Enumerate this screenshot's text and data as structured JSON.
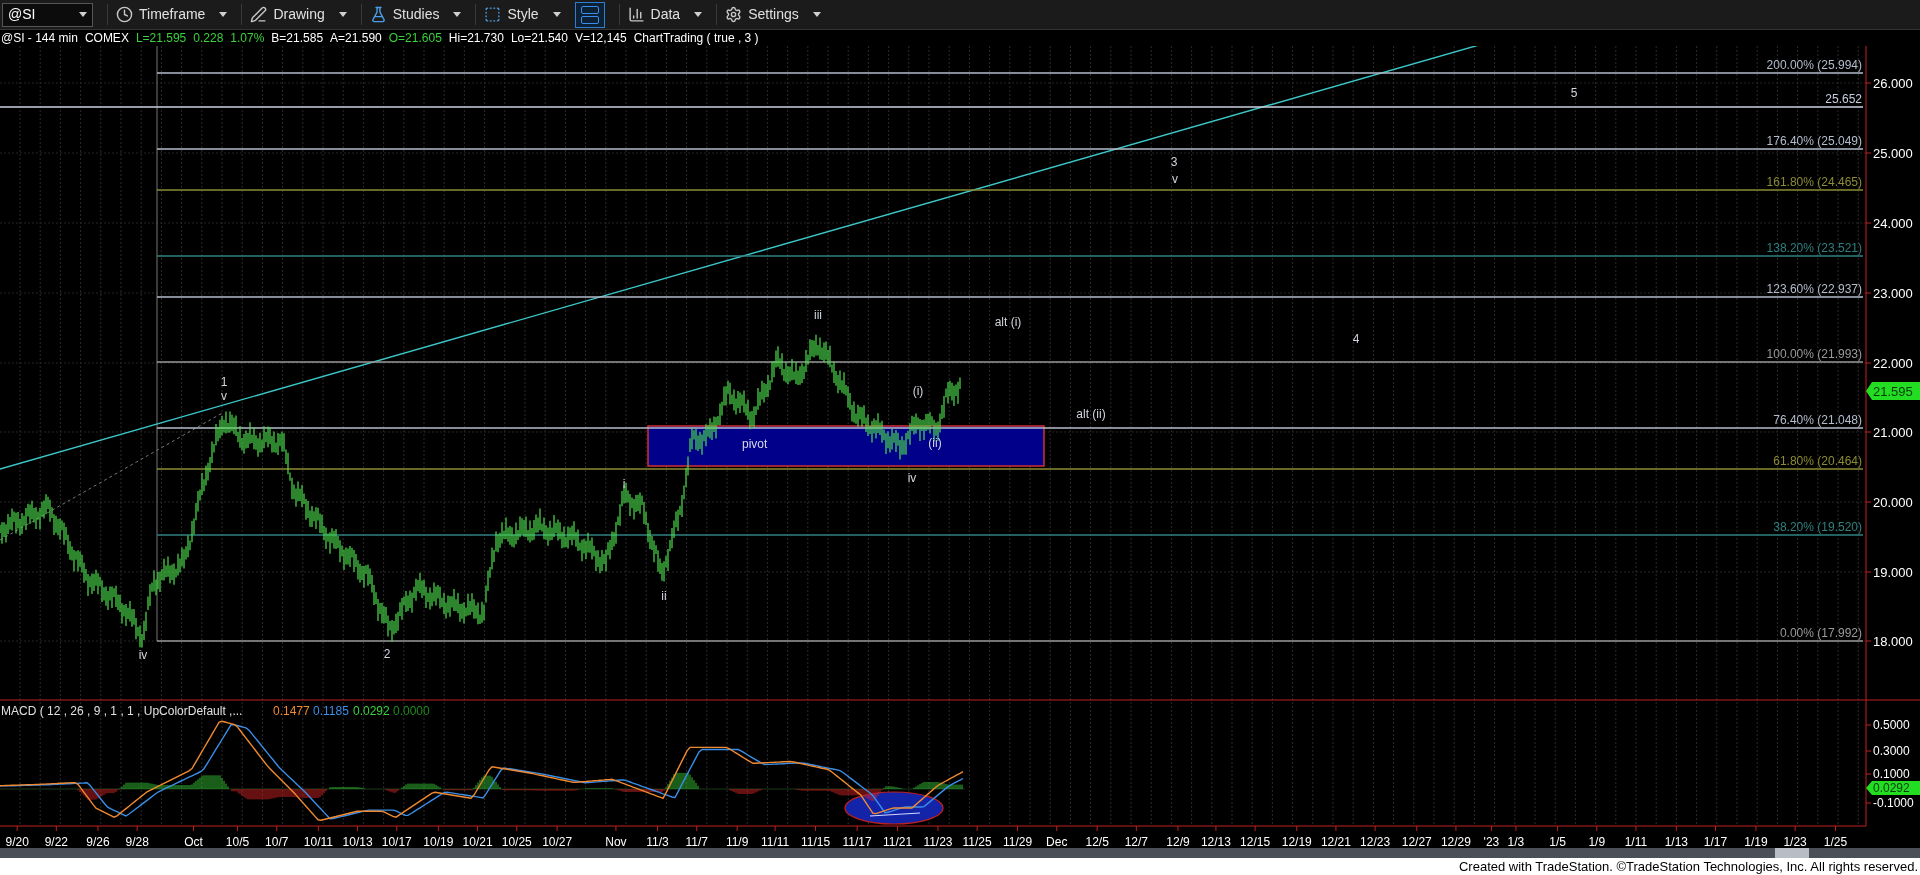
{
  "toolbar": {
    "symbol": "@SI",
    "menus": [
      {
        "label": "Timeframe"
      },
      {
        "label": "Drawing"
      },
      {
        "label": "Studies"
      },
      {
        "label": "Style"
      },
      {
        "label": "Data"
      },
      {
        "label": "Settings"
      }
    ],
    "layout_toggle": {
      "selected": true
    }
  },
  "info_line": [
    {
      "text": "@SI - 144 min",
      "color": "#ffffff"
    },
    {
      "text": "COMEX",
      "color": "#ffffff"
    },
    {
      "text": "L=21.595",
      "color": "#3ad13a"
    },
    {
      "text": "0.228",
      "color": "#3ad13a"
    },
    {
      "text": "1.07%",
      "color": "#3ad13a"
    },
    {
      "text": "B=21.585",
      "color": "#ffffff"
    },
    {
      "text": "A=21.590",
      "color": "#ffffff"
    },
    {
      "text": "O=21.605",
      "color": "#3ad13a"
    },
    {
      "text": "Hi=21.730",
      "color": "#ffffff"
    },
    {
      "text": "Lo=21.540",
      "color": "#ffffff"
    },
    {
      "text": "V=12,145",
      "color": "#ffffff"
    },
    {
      "text": "ChartTrading ( true , 3 )",
      "color": "#ffffff"
    }
  ],
  "price_axis": {
    "ticks": [
      "26.000",
      "25.000",
      "24.000",
      "23.000",
      "22.000",
      "21.000",
      "20.000",
      "19.000",
      "18.000"
    ],
    "last_price": "21.595"
  },
  "fib_levels": [
    {
      "label": "200.00% (25.994)",
      "color": "#b4bccc"
    },
    {
      "label": "25.652",
      "color": "#c8d0e0"
    },
    {
      "label": "176.40% (25.049)",
      "color": "#b4bccc"
    },
    {
      "label": "161.80% (24.465)",
      "color": "#8c8c34"
    },
    {
      "label": "138.20% (23.521)",
      "color": "#2f8080"
    },
    {
      "label": "123.60% (22.937)",
      "color": "#b4bccc"
    },
    {
      "label": "100.00% (21.993)",
      "color": "#9a9a9a"
    },
    {
      "label": "76.40% (21.048)",
      "color": "#b4bccc"
    },
    {
      "label": "61.80% (20.464)",
      "color": "#8c8c34"
    },
    {
      "label": "38.20% (19.520)",
      "color": "#2f8080"
    },
    {
      "label": "0.00% (17.992)",
      "color": "#9a9a9a"
    }
  ],
  "zone": {
    "label": "pivot"
  },
  "wave_labels": [
    "1",
    "v",
    "iv",
    "2",
    "i",
    "ii",
    "iii",
    "iv",
    "(i)",
    "(ii)",
    "alt (i)",
    "alt (ii)",
    "3",
    "v",
    "4",
    "5"
  ],
  "macd": {
    "title": "MACD ( 12 , 26 , 9 , 1 , 1 , UpColorDefault ,...",
    "values": [
      {
        "text": "0.1477",
        "color": "#f08a30"
      },
      {
        "text": "0.1185",
        "color": "#3a8ee8"
      },
      {
        "text": "0.0292",
        "color": "#3ad13a"
      },
      {
        "text": "0.0000",
        "color": "#1f8a1f"
      }
    ],
    "ticks": [
      "0.5000",
      "0.3000",
      "0.1000",
      "-0.1000"
    ],
    "last_value": "0.0292"
  },
  "dates": [
    "9/20",
    "9/22",
    "9/26",
    "9/28",
    "Oct",
    "10/5",
    "10/7",
    "10/11",
    "10/13",
    "10/17",
    "10/19",
    "10/21",
    "10/25",
    "10/27",
    "Nov",
    "11/3",
    "11/7",
    "11/9",
    "11/11",
    "11/15",
    "11/17",
    "11/21",
    "11/23",
    "11/25",
    "11/29",
    "Dec",
    "12/5",
    "12/7",
    "12/9",
    "12/13",
    "12/15",
    "12/19",
    "12/21",
    "12/23",
    "12/27",
    "12/29",
    "'23",
    "1/3",
    "1/5",
    "1/9",
    "1/11",
    "1/13",
    "1/17",
    "1/19",
    "1/23",
    "1/25"
  ],
  "footer": "Created with TradeStation. ©TradeStation Technologies, Inc. All rights reserved."
}
